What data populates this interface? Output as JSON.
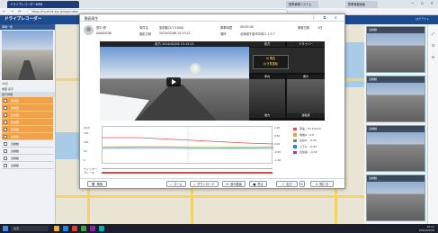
{
  "browser": {
    "active_tab": "ドライブレコーダーWEB",
    "tab2": "配車管理システム",
    "tab3": "配車管理画面",
    "window_controls": "— ☐ ✕",
    "url": "https://hq.drive-sys.jp/app/video",
    "nav_icons": "← → ⟳"
  },
  "app": {
    "title": "ドライブレコーダー",
    "header_right": "ログアウト"
  },
  "left_panel": {
    "header": "車両一覧",
    "rows": [
      "30日",
      "地図 表示"
    ],
    "section": "運行詳細",
    "items": [
      {
        "label": "急制動",
        "highlight": true
      },
      {
        "label": "急制動",
        "highlight": true
      },
      {
        "label": "急制動",
        "highlight": true
      },
      {
        "label": "急制動",
        "highlight": true
      },
      {
        "label": "急制動",
        "highlight": true
      },
      {
        "label": "急制動",
        "highlight": true
      },
      {
        "label": "急制動",
        "highlight": false
      },
      {
        "label": "急制動",
        "highlight": false
      },
      {
        "label": "急制動",
        "highlight": false
      },
      {
        "label": "急制動",
        "highlight": false
      }
    ]
  },
  "right_panel": {
    "thumbs": [
      "急制動",
      "急制動",
      "急制動",
      "急制動"
    ]
  },
  "modal": {
    "title": "動画再生",
    "icons": "ⓘ ⧉ ✕",
    "info": {
      "name": "田中 修",
      "code": "00000036",
      "l1": "事件名",
      "v1": "急制動(2/7/1000)",
      "l2": "撮影日時",
      "v2": "2024/02/06 15:15:21",
      "l3": "乗車時間",
      "v3": "00:00:00",
      "l4": "場所",
      "v4": "北海道千歳市平和２１８７",
      "l5": "乗務日数",
      "v5": "1日"
    },
    "video": {
      "main_label": "前方 2024/02/06 15:15:21",
      "side_head_left": "前方",
      "side_head_right": "ドライバー",
      "warning_text": "AI 警告",
      "warn_line2": "わき見運転",
      "cap_1": "車内",
      "cap_2": "側方",
      "foot_1": "後方",
      "foot_2": "運転席"
    },
    "chart": {
      "left_axis": [
        "150",
        "100",
        "50",
        "0"
      ],
      "left_units": "km/h",
      "right_axis": [
        "1.00",
        "0.50",
        "0.00",
        "-0.50",
        "-1.00"
      ],
      "row1": "ウインカー",
      "row2": "ブレーキ",
      "legend": [
        {
          "label": "車速 : 57.5 km/h",
          "color": "#e05252"
        },
        {
          "label": "前後G : 0.0",
          "color": "#f0a030"
        },
        {
          "label": "左右G : -0.03",
          "color": "#43a047"
        },
        {
          "label": "上下G : -0.03",
          "color": "#1e88e5"
        },
        {
          "label": "急加速 : -0.03",
          "color": "#8e44ad"
        }
      ]
    },
    "footer": {
      "delete": "削除",
      "zoom": "ズーム",
      "download": "ダウンロード",
      "prev": "前の動画",
      "stop": "停止",
      "export": "出力",
      "close": "閉じる"
    }
  },
  "taskbar": {
    "search": "検索",
    "time": "15:21",
    "date": "2024/02/06"
  }
}
